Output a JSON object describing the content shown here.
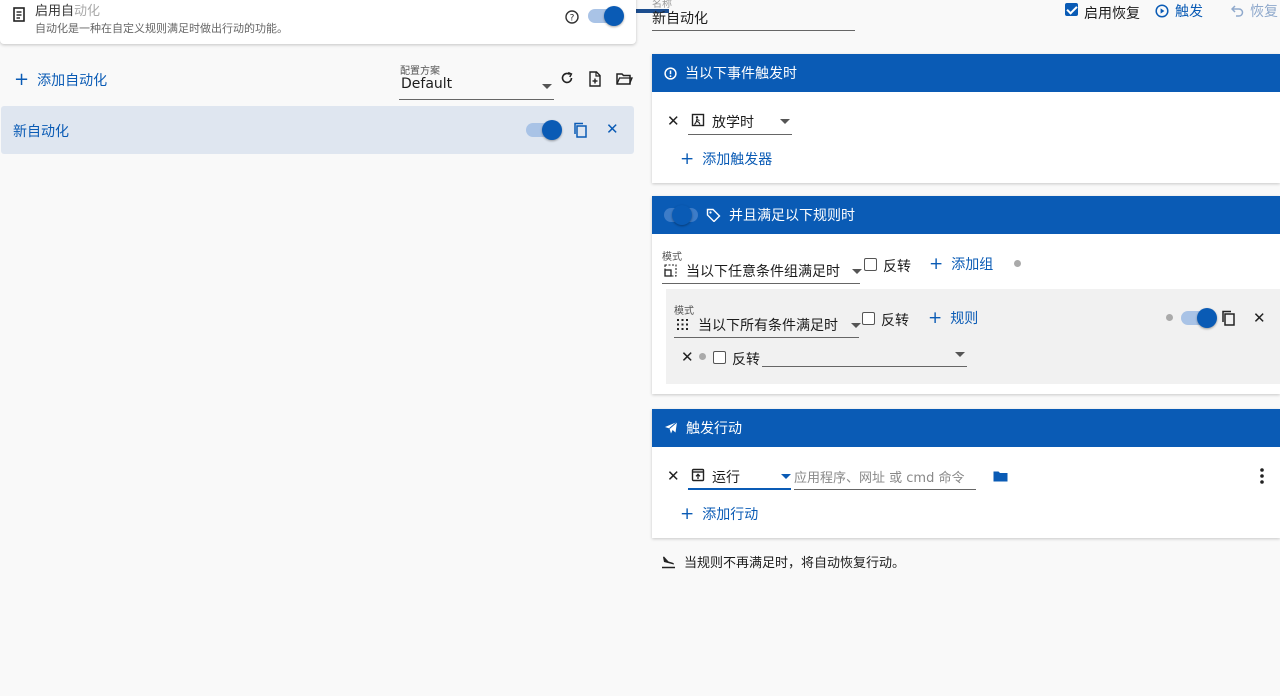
{
  "header": {
    "enable_label_a": "启用自",
    "enable_label_b": "动化",
    "description": "自动化是一种在自定义规则满足时做出行动的功能。",
    "name_field_label": "名称",
    "name_value": "新自动化",
    "enable_restore_label": "启用恢复",
    "trigger_button": "触发",
    "restore_button": "恢复"
  },
  "left": {
    "add_automation_label": "添加自动化",
    "profile_label": "配置方案",
    "profile_value": "Default",
    "items": [
      {
        "name": "新自动化",
        "enabled": true
      }
    ]
  },
  "triggers": {
    "title": "当以下事件触发时",
    "trigger_value": "放学时",
    "add_trigger_label": "添加触发器"
  },
  "rules": {
    "title": "并且满足以下规则时",
    "mode_label": "模式",
    "mode_value": "当以下任意条件组满足时",
    "invert_label": "反转",
    "add_group_label": "添加组",
    "group": {
      "mode_label": "模式",
      "mode_value": "当以下所有条件满足时",
      "invert_label": "反转",
      "add_rule_label": "规则",
      "rule_invert_label": "反转",
      "rule_value": ""
    }
  },
  "actions": {
    "title": "触发行动",
    "action_type": "运行",
    "command_placeholder": "应用程序、网址 或 cmd 命令",
    "add_action_label": "添加行动"
  },
  "footer_note": "当规则不再满足时，将自动恢复行动。",
  "colors": {
    "accent": "#0a5bb5",
    "selected_bg": "#dfe6f0"
  }
}
